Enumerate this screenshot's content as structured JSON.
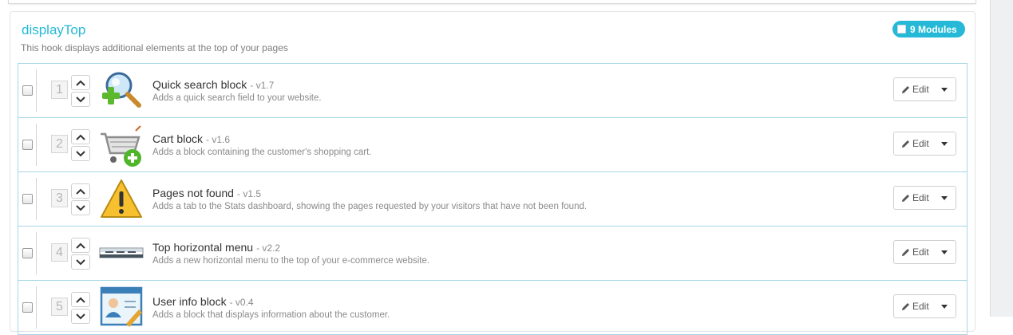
{
  "hook": {
    "title": "displayTop",
    "description": "This hook displays additional elements at the top of your pages",
    "count_label": "9 Modules"
  },
  "modules": [
    {
      "position": "1",
      "name": "Quick search block",
      "version": "- v1.7",
      "description": "Adds a quick search field to your website.",
      "icon": "magnifier-add-icon",
      "edit_label": "Edit"
    },
    {
      "position": "2",
      "name": "Cart block",
      "version": "- v1.6",
      "description": "Adds a block containing the customer's shopping cart.",
      "icon": "cart-add-icon",
      "edit_label": "Edit"
    },
    {
      "position": "3",
      "name": "Pages not found",
      "version": "- v1.5",
      "description": "Adds a tab to the Stats dashboard, showing the pages requested by your visitors that have not been found.",
      "icon": "warning-icon",
      "edit_label": "Edit"
    },
    {
      "position": "4",
      "name": "Top horizontal menu",
      "version": "- v2.2",
      "description": "Adds a new horizontal menu to the top of your e-commerce website.",
      "icon": "horizontal-menu-icon",
      "edit_label": "Edit"
    },
    {
      "position": "5",
      "name": "User info block",
      "version": "- v0.4",
      "description": "Adds a block that displays information about the customer.",
      "icon": "user-card-icon",
      "edit_label": "Edit"
    }
  ],
  "colors": {
    "accent": "#25b9d7",
    "row_border": "#a6d7e4"
  }
}
